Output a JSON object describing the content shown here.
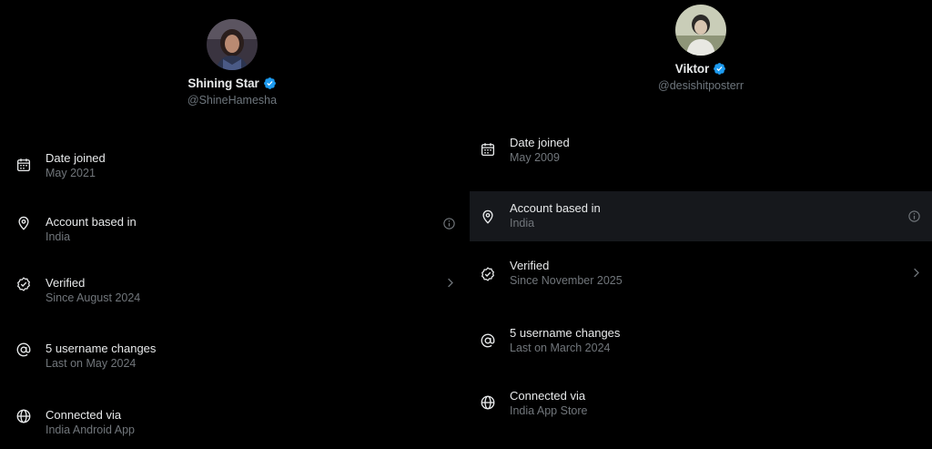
{
  "colors": {
    "background": "#000000",
    "primary_text": "#e7e9ea",
    "secondary_text": "#71767b",
    "verified_blue": "#1d9bf0",
    "hover_row": "#16181c"
  },
  "panels": [
    {
      "profile": {
        "name": "Shining Star",
        "handle": "@ShineHamesha",
        "verified": true
      },
      "rows": [
        {
          "icon": "calendar-icon",
          "title": "Date joined",
          "subtitle": "May 2021",
          "trail": null
        },
        {
          "icon": "location-pin-icon",
          "title": "Account based in",
          "subtitle": "India",
          "trail": "info-icon"
        },
        {
          "icon": "verified-check-icon",
          "title": "Verified",
          "subtitle": "Since August 2024",
          "trail": "chevron-right-icon"
        },
        {
          "icon": "at-sign-icon",
          "title": "5 username changes",
          "subtitle": "Last on May 2024",
          "trail": null
        },
        {
          "icon": "globe-icon",
          "title": "Connected via",
          "subtitle": "India Android App",
          "trail": null
        }
      ]
    },
    {
      "profile": {
        "name": "Viktor",
        "handle": "@desishitposterr",
        "verified": true
      },
      "rows": [
        {
          "icon": "calendar-icon",
          "title": "Date joined",
          "subtitle": "May 2009",
          "trail": null
        },
        {
          "icon": "location-pin-icon",
          "title": "Account based in",
          "subtitle": "India",
          "trail": "info-icon"
        },
        {
          "icon": "verified-check-icon",
          "title": "Verified",
          "subtitle": "Since November 2025",
          "trail": "chevron-right-icon"
        },
        {
          "icon": "at-sign-icon",
          "title": "5 username changes",
          "subtitle": "Last on March 2024",
          "trail": null
        },
        {
          "icon": "globe-icon",
          "title": "Connected via",
          "subtitle": "India App Store",
          "trail": null
        }
      ]
    }
  ]
}
